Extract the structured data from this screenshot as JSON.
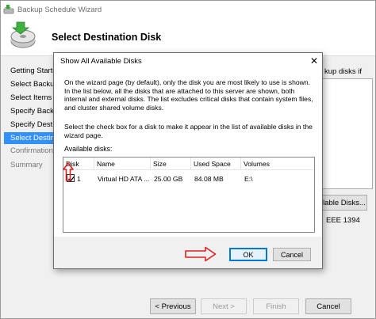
{
  "wizard": {
    "title": "Backup Schedule Wizard",
    "header_title": "Select Destination Disk",
    "steps": [
      {
        "label": "Getting Started",
        "state": "normal"
      },
      {
        "label": "Select Backup C",
        "state": "normal"
      },
      {
        "label": "Select Items for",
        "state": "normal"
      },
      {
        "label": "Specify Backup",
        "state": "normal"
      },
      {
        "label": "Specify Destina",
        "state": "normal"
      },
      {
        "label": "Select Destinati",
        "state": "selected"
      },
      {
        "label": "Confirmation",
        "state": "dim"
      },
      {
        "label": "Summary",
        "state": "dim"
      }
    ],
    "content_text_fragment": "kup disks if",
    "show_all_button_fragment": "lable Disks...",
    "ieee_fragment": "EEE 1394",
    "buttons": {
      "previous": "< Previous",
      "next": "Next >",
      "finish": "Finish",
      "cancel": "Cancel"
    }
  },
  "dialog": {
    "title": "Show All Available Disks",
    "close_glyph": "✕",
    "paragraph1": "On the wizard page (by default), only the disk you are most likely to use is shown. In the list below, all the disks that are attached to this server are shown, both internal and external disks. The list excludes critical disks that contain system files, and cluster shared volume disks.",
    "paragraph2": "Select the check box for a disk to make it appear in the list of available disks in the wizard page.",
    "available_label": "Available disks:",
    "columns": [
      "Disk",
      "Name",
      "Size",
      "Used Space",
      "Volumes"
    ],
    "rows": [
      {
        "checked": true,
        "disk": "1",
        "name": "Virtual HD ATA ...",
        "size": "25.00 GB",
        "used": "84.08 MB",
        "volumes": "E:\\"
      }
    ],
    "ok_label": "OK",
    "cancel_label": "Cancel"
  },
  "colors": {
    "selection_blue": "#3390ff",
    "default_button_border": "#0078d7",
    "annotation_red": "#e02020"
  },
  "icons": [
    "backup-app-icon",
    "backup-disk-icon",
    "close-icon",
    "checkmark-icon",
    "red-arrow-right-icon",
    "red-arrow-up-icon"
  ]
}
